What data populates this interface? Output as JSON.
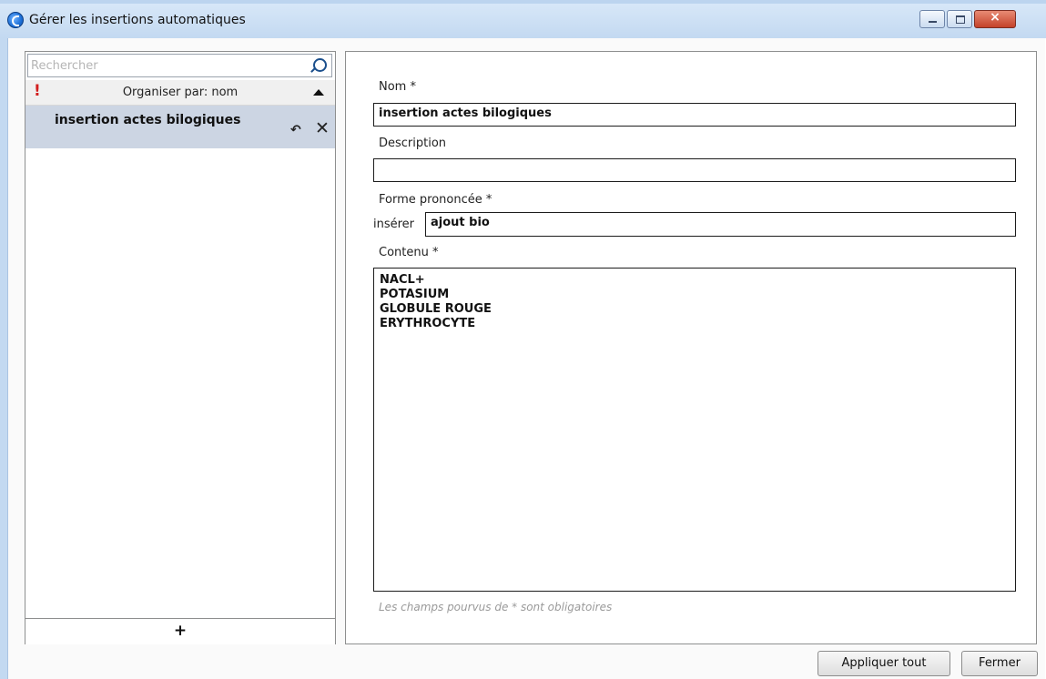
{
  "window": {
    "title": "Gérer les insertions automatiques",
    "icon": "dragon-app-icon",
    "controls": {
      "minimize": "minimize-icon",
      "maximize": "maximize-icon",
      "close": "×"
    }
  },
  "sidebar": {
    "search_placeholder": "Rechercher",
    "sort_label": "Organiser par: nom",
    "warning_glyph": "!",
    "items": [
      {
        "label": "insertion actes bilogiques",
        "undo_glyph": "↶",
        "delete_glyph": "✕"
      }
    ],
    "add_glyph": "+"
  },
  "form": {
    "name_label": "Nom *",
    "name_value": "insertion actes bilogiques",
    "description_label": "Description",
    "description_value": "",
    "spoken_label": "Forme prononcée *",
    "spoken_prefix": "insérer",
    "spoken_value": "ajout bio",
    "content_label": "Contenu *",
    "content_lines": [
      "NACL+",
      "POTASIUM",
      "GLOBULE ROUGE",
      "ERYTHROCYTE"
    ],
    "required_note": "Les champs pourvus de * sont obligatoires"
  },
  "buttons": {
    "apply_all": "Appliquer tout",
    "close": "Fermer"
  }
}
